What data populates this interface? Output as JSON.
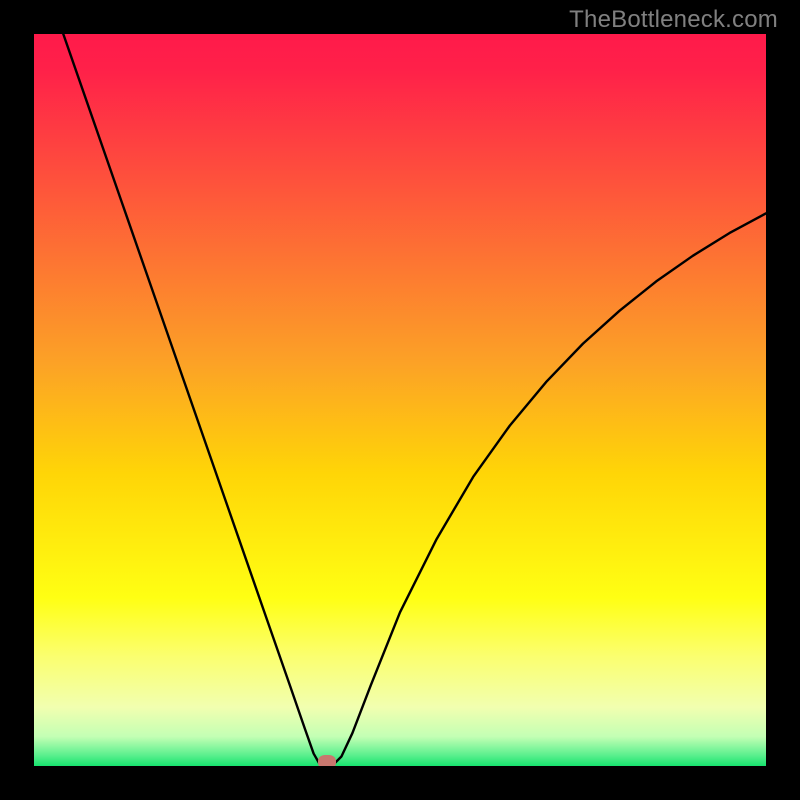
{
  "watermark": "TheBottleneck.com",
  "chart_data": {
    "type": "line",
    "title": "",
    "xlabel": "",
    "ylabel": "",
    "xlim": [
      0,
      100
    ],
    "ylim": [
      0,
      100
    ],
    "grid": false,
    "background_gradient": [
      {
        "stop": 0.0,
        "color": "#ff1a4a"
      },
      {
        "stop": 0.05,
        "color": "#ff2149"
      },
      {
        "stop": 0.45,
        "color": "#fca226"
      },
      {
        "stop": 0.6,
        "color": "#ffd507"
      },
      {
        "stop": 0.77,
        "color": "#ffff13"
      },
      {
        "stop": 0.85,
        "color": "#fbff6f"
      },
      {
        "stop": 0.92,
        "color": "#f1ffb0"
      },
      {
        "stop": 0.96,
        "color": "#c3ffb4"
      },
      {
        "stop": 0.985,
        "color": "#5cf08e"
      },
      {
        "stop": 1.0,
        "color": "#17e36e"
      }
    ],
    "series": [
      {
        "name": "bottleneck-curve",
        "color": "#000000",
        "x": [
          4,
          8,
          12,
          16,
          20,
          24,
          28,
          32,
          35,
          37,
          38.2,
          39,
          40,
          41,
          42,
          43.5,
          46,
          50,
          55,
          60,
          65,
          70,
          75,
          80,
          85,
          90,
          95,
          100
        ],
        "y": [
          100,
          88.5,
          77,
          65.5,
          54,
          42.5,
          31,
          19.5,
          10.9,
          5.1,
          1.7,
          0.3,
          0,
          0.3,
          1.3,
          4.5,
          11,
          21,
          31,
          39.5,
          46.5,
          52.5,
          57.7,
          62.2,
          66.2,
          69.7,
          72.8,
          75.5
        ]
      }
    ],
    "marker": {
      "x": 40,
      "y": 0.5,
      "color": "#c8776e"
    }
  }
}
